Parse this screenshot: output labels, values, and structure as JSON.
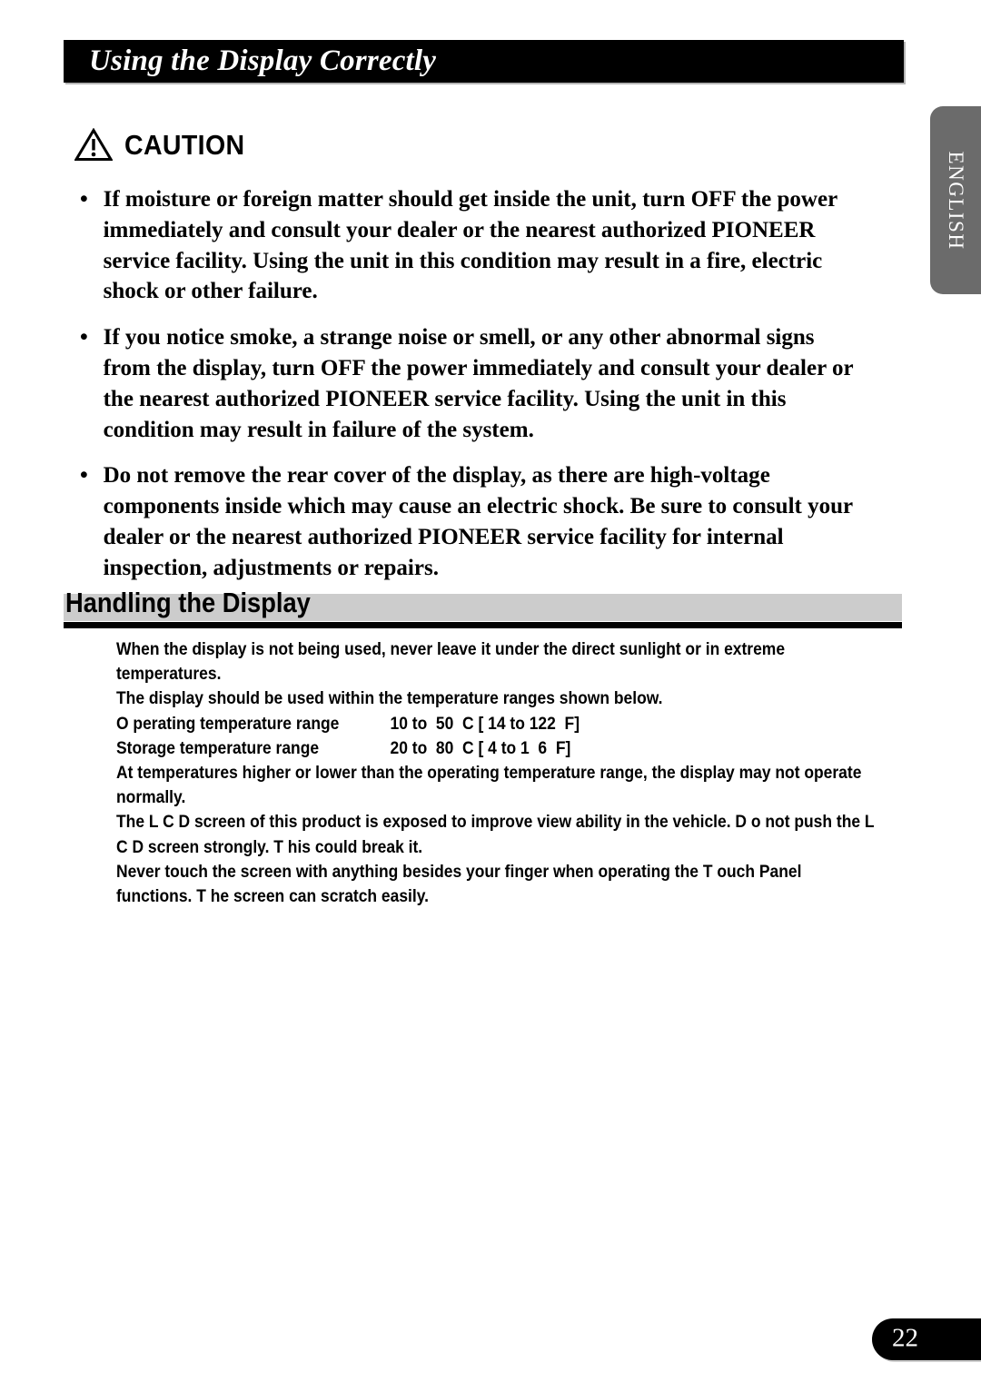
{
  "header": {
    "title": "Using the Display Correctly"
  },
  "language_tab": {
    "label": "ENGLISH"
  },
  "caution": {
    "icon": "warning-triangle-icon",
    "heading": "CAUTION",
    "bullet_char": "•",
    "items": [
      "If moisture or foreign matter should get inside the unit, turn OFF the power immediately and consult your dealer or the nearest authorized PIONEER service facility. Using the unit in this condition may result in a fire, electric shock or other failure.",
      "If you notice smoke, a strange noise or smell, or any other abnormal signs from the display, turn OFF the power immediately and consult your dealer or the nearest authorized PIONEER service facility. Using the unit in this condition may result in failure of the system.",
      "Do not remove the rear cover of the display, as there are high-voltage components inside which may cause an electric shock. Be sure to consult your dealer or the nearest authorized PIONEER service facility for internal inspection, adjustments or repairs."
    ]
  },
  "handling": {
    "section_title": "Handling the Display",
    "paragraph_1": "When the display is not being used, never leave it under the direct sunlight or in extreme temperatures.",
    "paragraph_2": "The display should be used within the temperature ranges shown below.",
    "temperature_rows": [
      {
        "label": "O perating temperature range",
        "value": "10 to  50  C [ 14 to 122  F]"
      },
      {
        "label": "Storage temperature range",
        "value": "20 to  80  C [ 4 to 1  6  F]"
      }
    ],
    "paragraph_3": "At temperatures higher or lower than the operating temperature range, the display may not operate normally.",
    "paragraph_4": "The L C D  screen of this product is exposed to improve view ability in the vehicle. D o not push the L C D  screen strongly. T his could break it.",
    "paragraph_5": "Never touch the screen with anything besides your finger when operating the T ouch Panel functions. T he screen can scratch easily."
  },
  "footer": {
    "page_number": "22"
  },
  "colors": {
    "title_bar_bg": "#000000",
    "band_gray": "#cccccc",
    "tab_gray": "#6b6b6b",
    "text_black": "#000000",
    "text_white": "#ffffff"
  }
}
